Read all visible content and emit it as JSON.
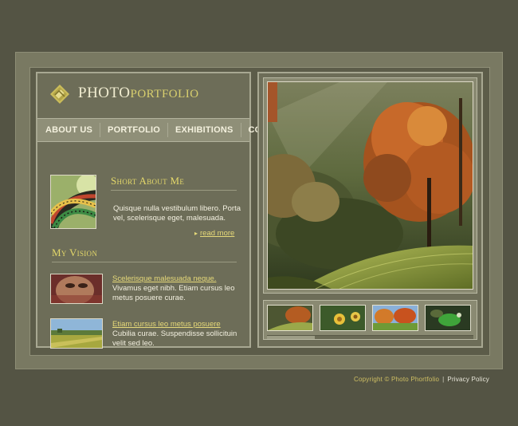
{
  "logo": {
    "part1": "PHOTO",
    "part2": "PORTFOLIO",
    "icon": "diamond-logo-icon"
  },
  "nav": [
    "ABOUT US",
    "PORTFOLIO",
    "EXHIBITIONS",
    "CONTACTS"
  ],
  "about": {
    "heading": "Short About Me",
    "text": "Quisque nulla vestibulum libero. Porta vel, scelerisque eget, malesuada.",
    "read_more": "read more"
  },
  "vision": {
    "heading": "My Vision",
    "items": [
      {
        "title": "Scelerisque malesuada neque.",
        "text": "Vivamus eget nibh. Etiam cursus leo metus posuere curae."
      },
      {
        "title": "Etiam cursus leo metus posuere",
        "text": "Cubilia curae. Suspendisse sollicituin velit sed leo."
      }
    ]
  },
  "footer": {
    "copyright": "Copyright © Photo Phortfolio",
    "separator": "|",
    "policy": "Privacy Policy"
  },
  "colors": {
    "background": "#545444",
    "panel": "#6d6d58",
    "accent": "#e4d86a"
  }
}
